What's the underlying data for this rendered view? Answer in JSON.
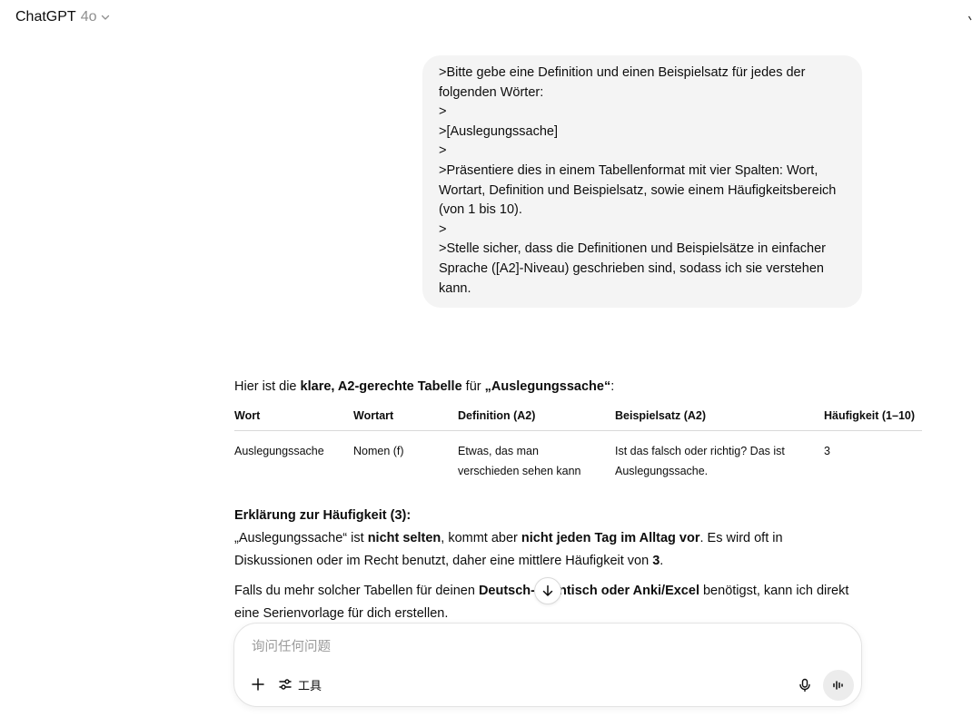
{
  "header": {
    "model_name": "ChatGPT",
    "model_version": "4o"
  },
  "user_message": {
    "lines": [
      ">Bitte gebe eine Definition und einen Beispielsatz für jedes der",
      "folgenden Wörter:",
      ">",
      ">[Auslegungssache]",
      ">",
      ">Präsentiere dies in einem Tabellenformat mit vier Spalten: Wort,",
      "Wortart, Definition und Beispielsatz, sowie einem Häufigkeitsbereich",
      "(von 1 bis 10).",
      ">",
      ">Stelle sicher, dass die Definitionen und Beispielsätze in einfacher",
      "Sprache ([A2]-Niveau) geschrieben sind, sodass ich sie verstehen",
      "kann."
    ]
  },
  "assistant": {
    "intro": {
      "pre": "Hier ist die ",
      "bold1": "klare, A2-gerechte Tabelle",
      "mid": " für ",
      "bold2": "„Auslegungssache“",
      "post": ":"
    },
    "table": {
      "headers": [
        "Wort",
        "Wortart",
        "Definition (A2)",
        "Beispielsatz (A2)",
        "Häufigkeit (1–10)"
      ],
      "rows": [
        {
          "wort": "Auslegungssache",
          "wortart": "Nomen (f)",
          "definition_l1": "Etwas, das man",
          "definition_l2": "verschieden sehen kann",
          "beispiel_l1": "Ist das falsch oder richtig? Das ist",
          "beispiel_l2": "Auslegungssache.",
          "haeufigkeit": "3"
        }
      ]
    },
    "explanation": {
      "title": "Erklärung zur Häufigkeit (3):",
      "t1": "„Auslegungssache“ ist ",
      "b1": "nicht selten",
      "t2": ", kommt aber ",
      "b2": "nicht jeden Tag im Alltag vor",
      "t3": ". Es wird oft in",
      "t4": "Diskussionen oder im Recht benutzt, daher eine mittlere Häufigkeit von ",
      "b3": "3",
      "t5": "."
    },
    "followup": {
      "t1": "Falls du mehr solcher Tabellen für deinen ",
      "b1": "Deutsch-",
      "b2": "ntisch oder Anki/Excel",
      "t2": " benötigst, kann ich direkt",
      "t3": "eine Serienvorlage für dich erstellen."
    }
  },
  "composer": {
    "placeholder": "询问任何问题",
    "tools_label": "工具"
  },
  "icons": {
    "chevron": "chevron-down-icon",
    "scroll_down": "arrow-down-icon",
    "plus": "plus-icon",
    "tools": "sliders-icon",
    "mic": "microphone-icon",
    "voice": "voice-mode-icon"
  },
  "colors": {
    "bubble_bg": "#f4f4f4",
    "text": "#0d0d0d",
    "muted": "#8f8f8f",
    "voice_btn_bg": "#ececec"
  }
}
